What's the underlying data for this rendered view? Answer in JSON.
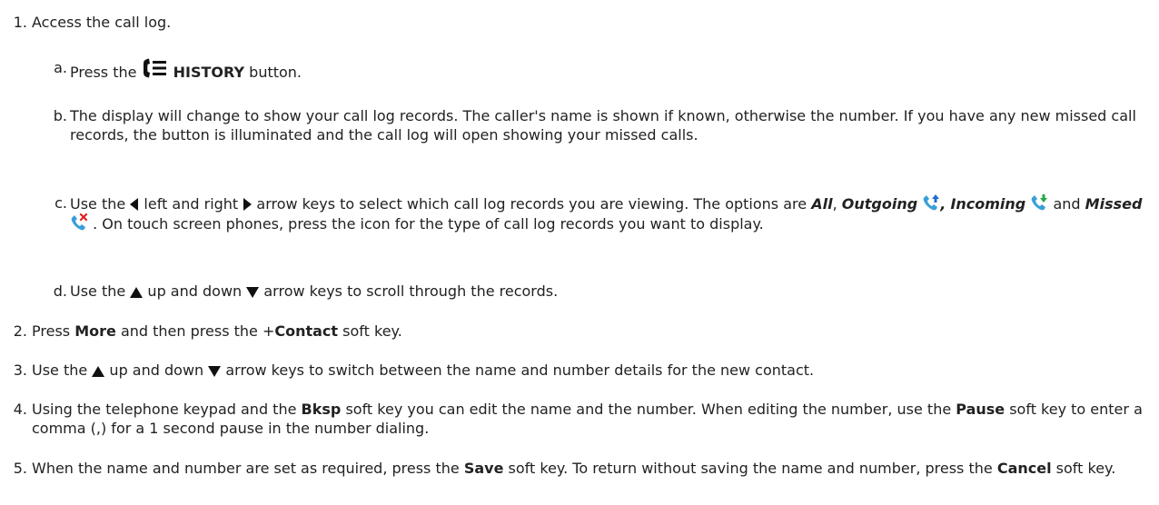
{
  "steps": [
    {
      "num": "1.",
      "text": "Access the call log.",
      "substeps": [
        {
          "num": "a.",
          "pre": "Press the",
          "bold": "HISTORY",
          "post": "button."
        },
        {
          "num": "b.",
          "text": "The display will change to show your call log records. The caller's name is shown if known, otherwise the number. If you have any new missed call records, the button is illuminated and the call log will open showing your missed calls."
        },
        {
          "num": "c.",
          "t1": "Use the",
          "t2": "left and right",
          "t3": "arrow keys to select which call log records you are viewing. The options are",
          "opt_all": "All",
          "comma1": ",",
          "opt_out": "Outgoing",
          "comma2": ",",
          "opt_in": "Incoming",
          "and": "and",
          "opt_missed": "Missed",
          "t4": ". On touch screen phones, press the icon for the type of call log records you want to display."
        },
        {
          "num": "d.",
          "t1": "Use the",
          "t2": "up and down",
          "t3": "arrow keys to scroll through the records."
        }
      ]
    },
    {
      "num": "2.",
      "t1": "Press",
      "b1": "More",
      "t2": "and then press the +",
      "b2": "Contact",
      "t3": "soft key."
    },
    {
      "num": "3.",
      "t1": "Use the",
      "t2": "up and down",
      "t3": "arrow keys to switch between the name and number details for the new contact."
    },
    {
      "num": "4.",
      "t1": "Using the telephone keypad and the",
      "b1": "Bksp",
      "t2": "soft key you can edit the name and the number. When editing the number, use the",
      "b2": "Pause",
      "t3": "soft key to enter a comma (,) for a 1 second pause in the number dialing."
    },
    {
      "num": "5.",
      "t1": "When the name and number are set as required, press the",
      "b1": "Save",
      "t2": "soft key. To return without saving the name and number, press the",
      "b2": "Cancel",
      "t3": "soft key."
    }
  ],
  "icons": {
    "history": "history-icon",
    "left": "left-arrow-icon",
    "right": "right-arrow-icon",
    "up": "up-arrow-icon",
    "down": "down-arrow-icon",
    "outgoing": "outgoing-call-icon",
    "incoming": "incoming-call-icon",
    "missed": "missed-call-icon"
  },
  "colors": {
    "text": "#222222",
    "icon": "#111111",
    "handset": "#3a9fd8",
    "outgoing_arrow": "#1f6fd0",
    "incoming_arrow": "#28a745",
    "missed_x": "#e02020"
  }
}
